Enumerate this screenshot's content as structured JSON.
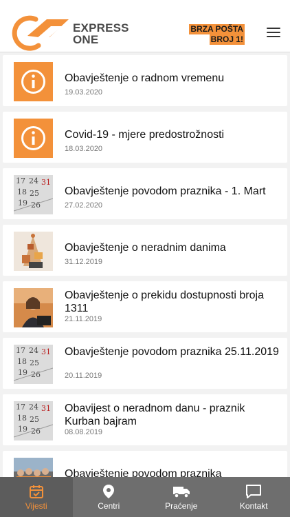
{
  "colors": {
    "accent": "#f3913a",
    "tabbar": "#6e6e6e",
    "text": "#111111",
    "muted": "#777777"
  },
  "header": {
    "brand_line1": "EXPRESS",
    "brand_line2": "ONE",
    "slogan_line1": "BRZA POŠTA",
    "slogan_line2": "BROJ 1!",
    "menu_icon": "hamburger-icon"
  },
  "news": [
    {
      "title": "Obavještenje o radnom vremenu",
      "date": "19.03.2020",
      "image": "info-icon"
    },
    {
      "title": "Covid-19 - mjere predostrožnosti",
      "date": "18.03.2020",
      "image": "info-icon"
    },
    {
      "title": "Obavještenje povodom praznika - 1. Mart",
      "date": "27.02.2020",
      "image": "calendar-photo"
    },
    {
      "title": "Obavještenje o neradnim danima",
      "date": "31.12.2019",
      "image": "gifts-photo"
    },
    {
      "title": "Obavještenje o prekidu dostupnosti broja 1311",
      "date": "21.11.2019",
      "image": "call-center-photo"
    },
    {
      "title": "Obavještenje povodom praznika 25.11.2019",
      "date": "20.11.2019",
      "image": "calendar-photo"
    },
    {
      "title": "Obavijest o neradnom danu - praznik Kurban bajram",
      "date": "08.08.2019",
      "image": "calendar-photo"
    },
    {
      "title": "Obavještenje povodom praznika",
      "date": "",
      "image": "team-photo"
    }
  ],
  "tabs": [
    {
      "label": "Vijesti",
      "icon": "calendar-check-icon",
      "active": true
    },
    {
      "label": "Centri",
      "icon": "map-pin-icon",
      "active": false
    },
    {
      "label": "Praćenje",
      "icon": "truck-icon",
      "active": false
    },
    {
      "label": "Kontakt",
      "icon": "chat-icon",
      "active": false
    }
  ]
}
